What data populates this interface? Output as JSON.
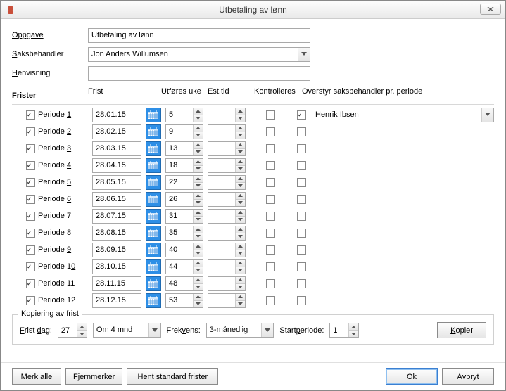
{
  "window": {
    "title": "Utbetaling av lønn"
  },
  "form": {
    "oppgave_label": "Oppgave",
    "oppgave_value": "Utbetaling av lønn",
    "saksbehandler_label": "Saksbehandler",
    "saksbehandler_value": "Jon Anders Willumsen",
    "henvisning_label": "Henvisning",
    "henvisning_value": ""
  },
  "frister": {
    "heading": "Frister",
    "columns": {
      "frist": "Frist",
      "uke": "Utføres uke",
      "est": "Est.tid",
      "kontroll": "Kontrolleres",
      "overstyr": "Overstyr saksbehandler pr. periode"
    },
    "rows": [
      {
        "checked": true,
        "label_pre": "Periode ",
        "label_num": "1",
        "label_u": "1",
        "dato": "28.01.15",
        "uke": "5",
        "est": "",
        "kontroll": false,
        "overstyr": true,
        "overstyr_value": "Henrik Ibsen"
      },
      {
        "checked": true,
        "label_pre": "Periode ",
        "label_num": "2",
        "label_u": "2",
        "dato": "28.02.15",
        "uke": "9",
        "est": "",
        "kontroll": false,
        "overstyr": false,
        "overstyr_value": ""
      },
      {
        "checked": true,
        "label_pre": "Periode ",
        "label_num": "3",
        "label_u": "3",
        "dato": "28.03.15",
        "uke": "13",
        "est": "",
        "kontroll": false,
        "overstyr": false,
        "overstyr_value": ""
      },
      {
        "checked": true,
        "label_pre": "Periode ",
        "label_num": "4",
        "label_u": "4",
        "dato": "28.04.15",
        "uke": "18",
        "est": "",
        "kontroll": false,
        "overstyr": false,
        "overstyr_value": ""
      },
      {
        "checked": true,
        "label_pre": "Periode ",
        "label_num": "5",
        "label_u": "5",
        "dato": "28.05.15",
        "uke": "22",
        "est": "",
        "kontroll": false,
        "overstyr": false,
        "overstyr_value": ""
      },
      {
        "checked": true,
        "label_pre": "Periode ",
        "label_num": "6",
        "label_u": "6",
        "dato": "28.06.15",
        "uke": "26",
        "est": "",
        "kontroll": false,
        "overstyr": false,
        "overstyr_value": ""
      },
      {
        "checked": true,
        "label_pre": "Periode ",
        "label_num": "7",
        "label_u": "7",
        "dato": "28.07.15",
        "uke": "31",
        "est": "",
        "kontroll": false,
        "overstyr": false,
        "overstyr_value": ""
      },
      {
        "checked": true,
        "label_pre": "Periode ",
        "label_num": "8",
        "label_u": "8",
        "dato": "28.08.15",
        "uke": "35",
        "est": "",
        "kontroll": false,
        "overstyr": false,
        "overstyr_value": ""
      },
      {
        "checked": true,
        "label_pre": "Periode ",
        "label_num": "9",
        "label_u": "9",
        "dato": "28.09.15",
        "uke": "40",
        "est": "",
        "kontroll": false,
        "overstyr": false,
        "overstyr_value": ""
      },
      {
        "checked": true,
        "label_pre": "Periode ",
        "label_num": "10",
        "label_u": "0",
        "dato": "28.10.15",
        "uke": "44",
        "est": "",
        "kontroll": false,
        "overstyr": false,
        "overstyr_value": ""
      },
      {
        "checked": true,
        "label_pre": "Periode ",
        "label_num": "11",
        "label_u": "",
        "dato": "28.11.15",
        "uke": "48",
        "est": "",
        "kontroll": false,
        "overstyr": false,
        "overstyr_value": ""
      },
      {
        "checked": true,
        "label_pre": "Periode ",
        "label_num": "12",
        "label_u": "",
        "dato": "28.12.15",
        "uke": "53",
        "est": "",
        "kontroll": false,
        "overstyr": false,
        "overstyr_value": ""
      }
    ]
  },
  "kopiering": {
    "legend": "Kopiering av frist",
    "frist_dag_label": "Frist dag:",
    "frist_dag_value": "27",
    "periode_value": "Om 4 mnd",
    "frekvens_label": "Frekvens:",
    "frekvens_value": "3-månedlig",
    "start_label": "Startperiode:",
    "start_value": "1",
    "kopier_btn": "Kopier"
  },
  "footer": {
    "merk_alle": "Merk alle",
    "fjern_merker": "Fjern merker",
    "hent_standard": "Hent standard frister",
    "ok": "Ok",
    "avbryt": "Avbryt"
  }
}
